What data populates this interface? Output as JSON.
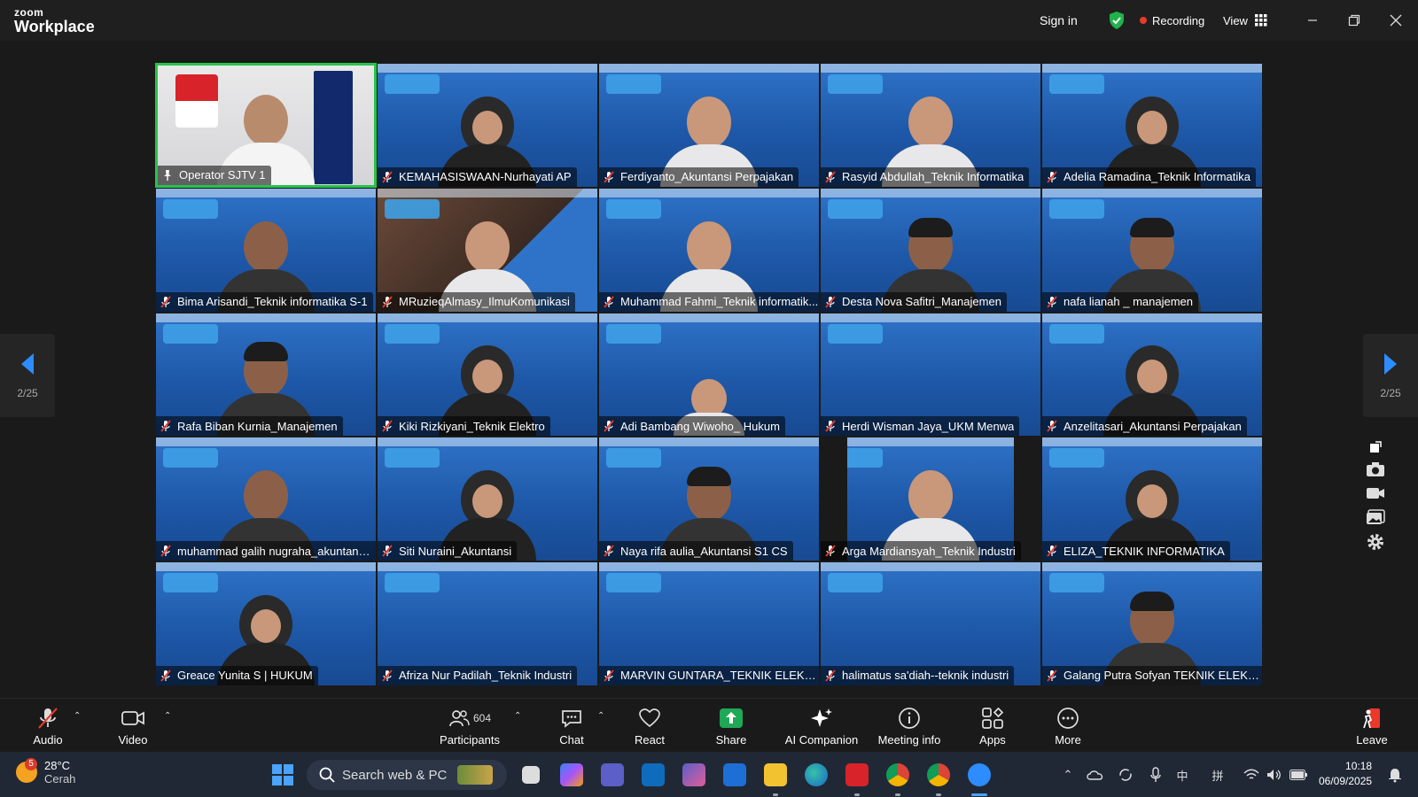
{
  "app": {
    "brand_small": "zoom",
    "brand_big": "Workplace"
  },
  "titlebar": {
    "sign_in": "Sign in",
    "recording": "Recording",
    "view": "View"
  },
  "participants": [
    {
      "name": "Operator SJTV 1",
      "mic": "pin"
    },
    {
      "name": "KEMAHASISWAAN-Nurhayati AP",
      "mic": "muted"
    },
    {
      "name": "Ferdiyanto_Akuntansi Perpajakan",
      "mic": "muted"
    },
    {
      "name": "Rasyid Abdullah_Teknik Informatika",
      "mic": "muted"
    },
    {
      "name": "Adelia Ramadina_Teknik Informatika",
      "mic": "muted"
    },
    {
      "name": "Bima Arisandi_Teknik informatika S-1",
      "mic": "muted"
    },
    {
      "name": "MRuzieqAlmasy_IlmuKomunikasi",
      "mic": "muted"
    },
    {
      "name": "Muhammad Fahmi_Teknik informatik...",
      "mic": "muted"
    },
    {
      "name": "Desta Nova Safitri_Manajemen",
      "mic": "muted"
    },
    {
      "name": "nafa lianah _ manajemen",
      "mic": "muted"
    },
    {
      "name": "Rafa Biban Kurnia_Manajemen",
      "mic": "muted"
    },
    {
      "name": "Kiki Rizkiyani_Teknik Elektro",
      "mic": "muted"
    },
    {
      "name": "Adi Bambang Wiwoho_ Hukum",
      "mic": "muted"
    },
    {
      "name": "Herdi Wisman Jaya_UKM Menwa",
      "mic": "muted"
    },
    {
      "name": "Anzelitasari_Akuntansi Perpajakan",
      "mic": "muted"
    },
    {
      "name": "muhammad galih nugraha_akuntansi...",
      "mic": "muted"
    },
    {
      "name": "Siti Nuraini_Akuntansi",
      "mic": "muted"
    },
    {
      "name": "Naya rifa aulia_Akuntansi S1 CS",
      "mic": "muted"
    },
    {
      "name": "Arga Mardiansyah_Teknik Industri",
      "mic": "muted"
    },
    {
      "name": "ELIZA_TEKNIK INFORMATIKA",
      "mic": "muted"
    },
    {
      "name": "Greace Yunita S | HUKUM",
      "mic": "muted"
    },
    {
      "name": "Afriza Nur Padilah_Teknik Industri",
      "mic": "muted"
    },
    {
      "name": "MARVIN GUNTARA_TEKNIK ELEKTRO...",
      "mic": "muted"
    },
    {
      "name": "halimatus sa'diah--teknik industri",
      "mic": "muted"
    },
    {
      "name": "Galang Putra Sofyan TEKNIK ELEKTRO",
      "mic": "muted"
    }
  ],
  "pager": {
    "left_label": "2/25",
    "right_label": "2/25"
  },
  "toolbar": {
    "audio": "Audio",
    "video": "Video",
    "participants": "Participants",
    "participants_count": "604",
    "chat": "Chat",
    "react": "React",
    "share": "Share",
    "ai_companion": "AI Companion",
    "meeting_info": "Meeting info",
    "apps": "Apps",
    "more": "More",
    "leave": "Leave"
  },
  "taskbar": {
    "weather_badge": "5",
    "temperature": "28°C",
    "condition": "Cerah",
    "search_placeholder": "Search web & PC",
    "ime": "中",
    "ime2": "拼",
    "time": "10:18",
    "date": "06/09/2025"
  },
  "colors": {
    "accent_green": "#27c34a",
    "record_red": "#e8392b",
    "share_green": "#1fa855",
    "leave_red": "#e8392b"
  }
}
